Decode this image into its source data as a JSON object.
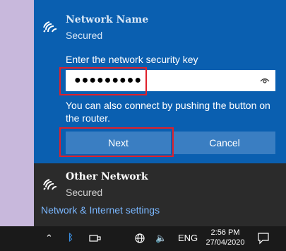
{
  "selected_network": {
    "name": "Network Name",
    "status": "Secured",
    "key_label": "Enter the network security key",
    "key_value": "●●●●●●●●●",
    "help_text": "You can also connect by pushing the button on the router.",
    "next_label": "Next",
    "cancel_label": "Cancel"
  },
  "other_network": {
    "name": "Other Network",
    "status": "Secured"
  },
  "settings_link": "Network & Internet settings",
  "taskbar": {
    "language": "ENG",
    "time": "2:56 PM",
    "date": "27/04/2020"
  },
  "colors": {
    "selected_bg": "#0a5fb0",
    "button_bg": "#3a7ec2",
    "highlight": "#e0202a",
    "link": "#7ab7ff"
  }
}
